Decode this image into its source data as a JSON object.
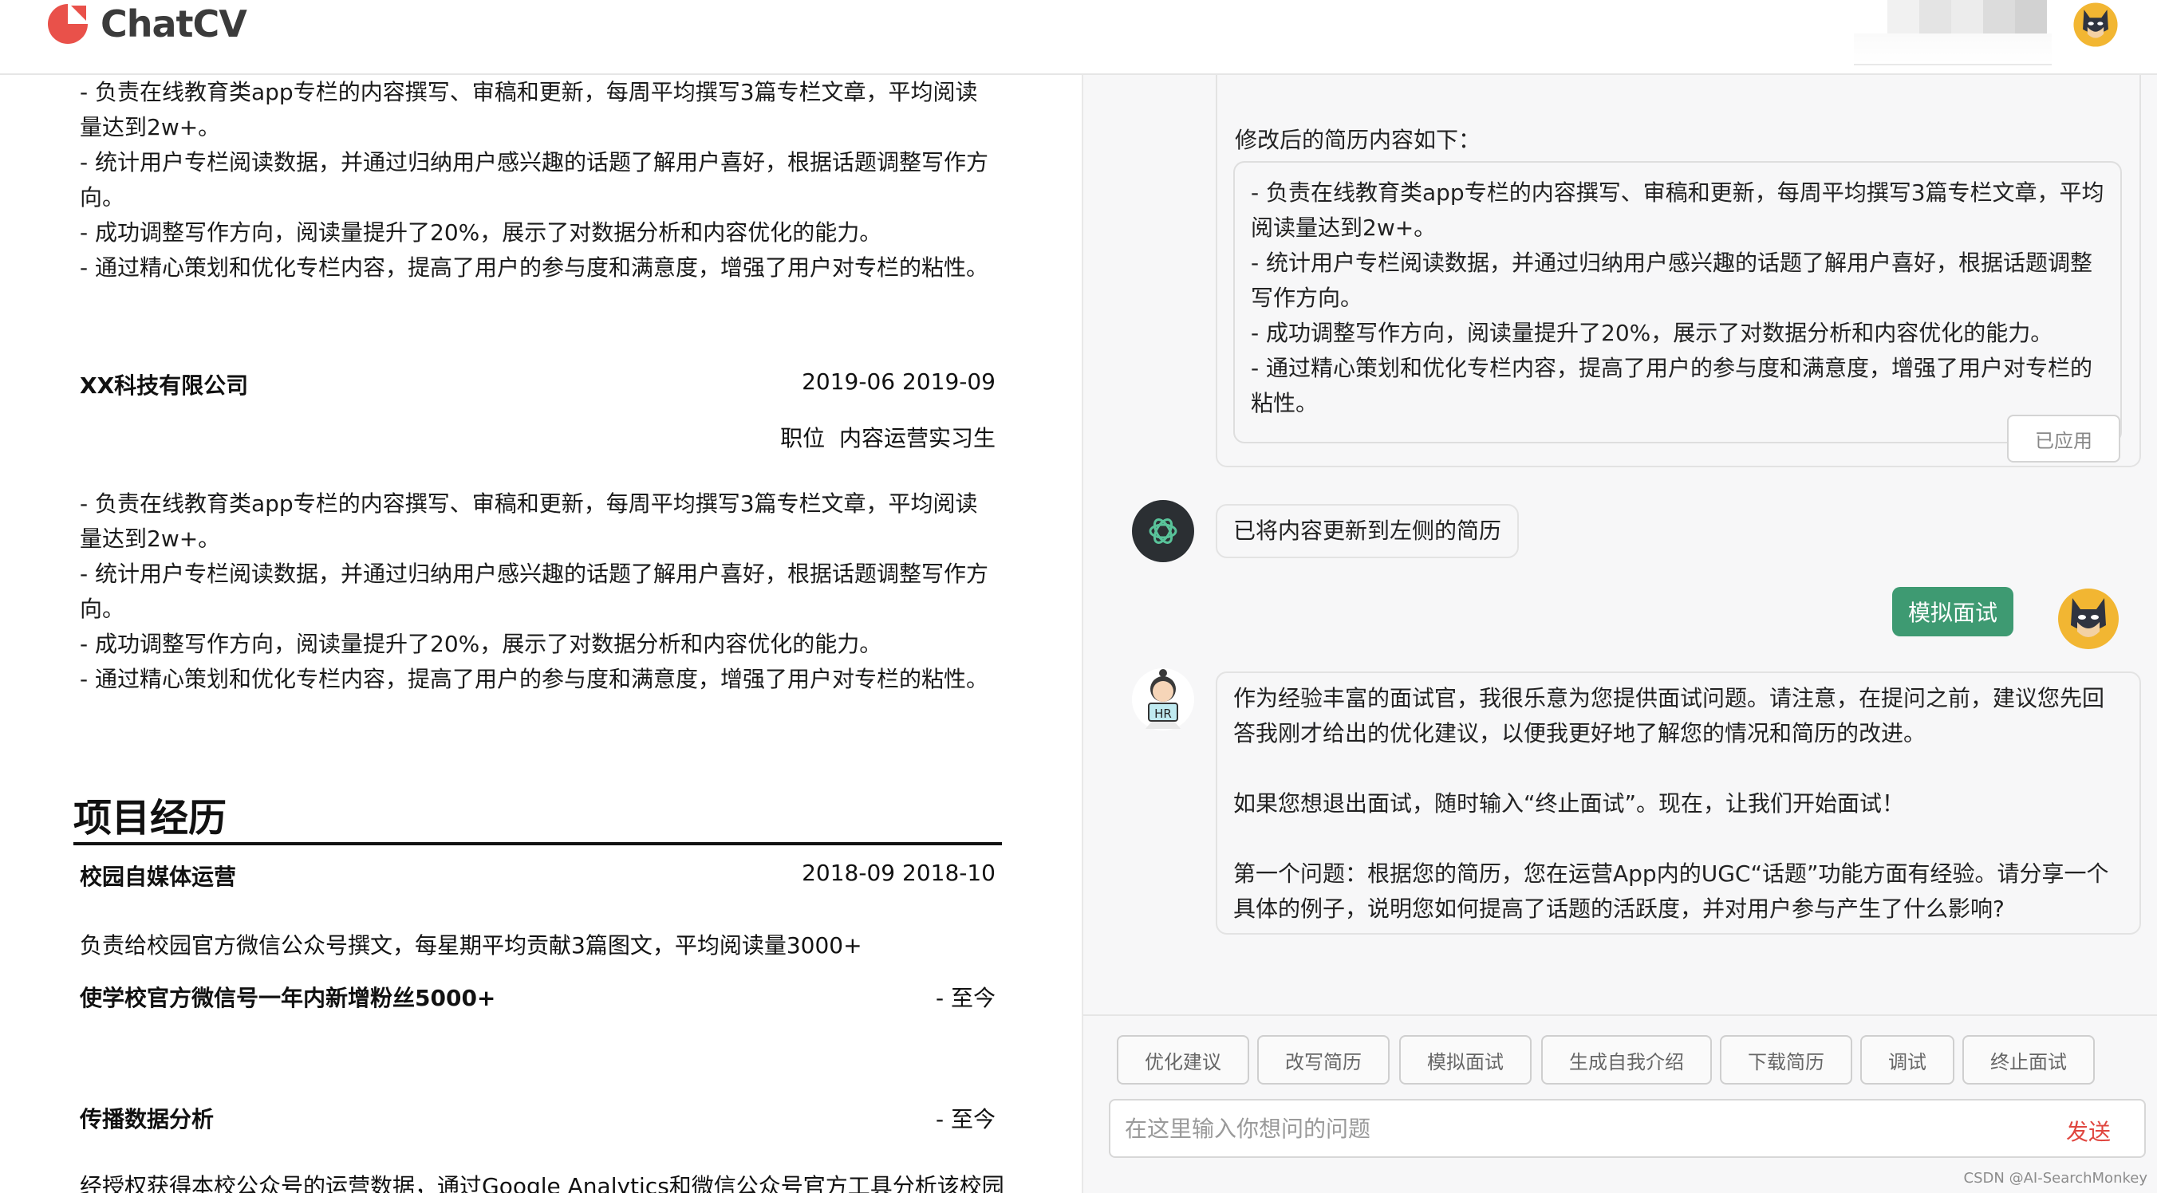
{
  "app": {
    "title": "ChatCV",
    "brand_color": "#e9514a",
    "pixel_colors": [
      "#eeeeee",
      "#e2e2e2",
      "#e9e9e9",
      "#d9d9d9",
      "#cfcfcf"
    ]
  },
  "resume": {
    "job1_bullets": [
      " - 负责在线教育类app专栏的内容撰写、审稿和更新，每周平均撰写3篇专栏文章，平均阅读量达到2w+。",
      " - 统计用户专栏阅读数据，并通过归纳用户感兴趣的话题了解用户喜好，根据话题调整写作方向。",
      " - 成功调整写作方向，阅读量提升了20%，展示了对数据分析和内容优化的能力。",
      " - 通过精心策划和优化专栏内容，提高了用户的参与度和满意度，增强了用户对专栏的粘性。"
    ],
    "job2": {
      "company": "XX科技有限公司",
      "dates": "2019-06 2019-09",
      "position_label": "职位",
      "position": "内容运营实习生",
      "bullets": [
        " - 负责在线教育类app专栏的内容撰写、审稿和更新，每周平均撰写3篇专栏文章，平均阅读量达到2w+。",
        " - 统计用户专栏阅读数据，并通过归纳用户感兴趣的话题了解用户喜好，根据话题调整写作方向。",
        " - 成功调整写作方向，阅读量提升了20%，展示了对数据分析和内容优化的能力。",
        " - 通过精心策划和优化专栏内容，提高了用户的参与度和满意度，增强了用户对专栏的粘性。"
      ]
    },
    "projects_heading": "项目经历",
    "project1": {
      "name": "校园自媒体运营",
      "dates": "2018-09 2018-10",
      "desc": "负责给校园官方微信公众号撰文，每星期平均贡献3篇图文，平均阅读量3000+",
      "highlight": "使学校官方微信号一年内新增粉丝5000+",
      "highlight_date": "- 至今"
    },
    "project2": {
      "name": "传播数据分析",
      "dates": "- 至今",
      "desc": "经授权获得本校公众号的运营数据，通过Google Analytics和微信公众号官方工具分析该校园"
    }
  },
  "chat": {
    "modified_label": "修改后的简历内容如下：",
    "modified_bullets": [
      " - 负责在线教育类app专栏的内容撰写、审稿和更新，每周平均撰写3篇专栏文章，平均阅读量达到2w+。",
      " - 统计用户专栏阅读数据，并通过归纳用户感兴趣的话题了解用户喜好，根据话题调整写作方向。",
      " - 成功调整写作方向，阅读量提升了20%，展示了对数据分析和内容优化的能力。",
      " - 通过精心策划和优化专栏内容，提高了用户的参与度和满意度，增强了用户对专栏的粘性。"
    ],
    "applied_button": "已应用",
    "bot_message": "已将内容更新到左侧的简历",
    "user_message": "模拟面试",
    "hr_label": "HR",
    "hr_paragraphs": [
      "作为经验丰富的面试官，我很乐意为您提供面试问题。请注意，在提问之前，建议您先回答我刚才给出的优化建议，以便我更好地了解您的情况和简历的改进。",
      "",
      "如果您想退出面试，随时输入“终止面试”。现在，让我们开始面试！",
      "",
      "第一个问题：根据您的简历，您在运营App内的UGC“话题”功能方面有经验。请分享一个具体的例子，说明您如何提高了话题的活跃度，并对用户参与产生了什么影响?"
    ],
    "user_bubble_color": "#3e9a72"
  },
  "toolbar": {
    "buttons": [
      "优化建议",
      "改写简历",
      "模拟面试",
      "生成自我介绍",
      "下载简历",
      "调试",
      "终止面试"
    ],
    "input_placeholder": "在这里输入你想问的问题",
    "send_label": "发送",
    "send_color": "#e0463f"
  },
  "watermark": "CSDN @AI-SearchMonkey"
}
